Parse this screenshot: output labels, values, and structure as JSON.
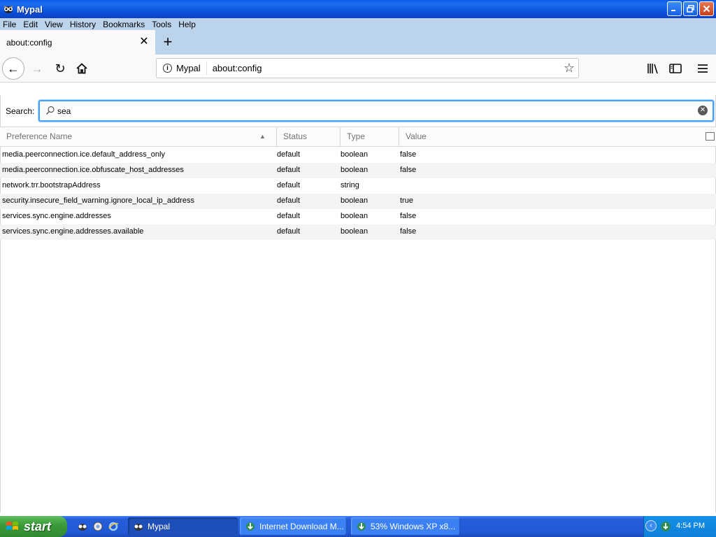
{
  "window": {
    "title": "Mypal",
    "minimize_label": "_",
    "maximize_label": "❐",
    "close_label": "✕"
  },
  "menubar": {
    "items": [
      "File",
      "Edit",
      "View",
      "History",
      "Bookmarks",
      "Tools",
      "Help"
    ]
  },
  "tabs": [
    {
      "label": "about:config",
      "close_glyph": "✕"
    }
  ],
  "new_tab_glyph": "+",
  "nav": {
    "back_glyph": "←",
    "forward_glyph": "→",
    "reload_glyph": "↻",
    "identity_label": "Mypal",
    "info_glyph": "i",
    "url": "about:config",
    "star_glyph": "☆"
  },
  "config": {
    "search_label": "Search:",
    "search_value": "sea",
    "clear_glyph": "✕",
    "columns": {
      "name": "Preference Name",
      "status": "Status",
      "type": "Type",
      "value": "Value"
    },
    "sort_glyph": "▲",
    "rows": [
      {
        "name": "media.peerconnection.ice.default_address_only",
        "status": "default",
        "type": "boolean",
        "value": "false"
      },
      {
        "name": "media.peerconnection.ice.obfuscate_host_addresses",
        "status": "default",
        "type": "boolean",
        "value": "false"
      },
      {
        "name": "network.trr.bootstrapAddress",
        "status": "default",
        "type": "string",
        "value": ""
      },
      {
        "name": "security.insecure_field_warning.ignore_local_ip_address",
        "status": "default",
        "type": "boolean",
        "value": "true"
      },
      {
        "name": "services.sync.engine.addresses",
        "status": "default",
        "type": "boolean",
        "value": "false"
      },
      {
        "name": "services.sync.engine.addresses.available",
        "status": "default",
        "type": "boolean",
        "value": "false"
      }
    ]
  },
  "taskbar": {
    "start_label": "start",
    "tasks": [
      {
        "label": "Mypal",
        "active": true
      },
      {
        "label": "Internet Download M...",
        "active": false
      },
      {
        "label": "53% Windows XP x8...",
        "active": false
      }
    ],
    "tray_arrow_glyph": "‹",
    "clock": "4:54 PM"
  },
  "colors": {
    "titlebar": "#0a5ce6",
    "menubar": "#bcd3ec",
    "focus_ring": "#45a1ff",
    "taskbar": "#245edb",
    "start": "#3c9c3c"
  }
}
